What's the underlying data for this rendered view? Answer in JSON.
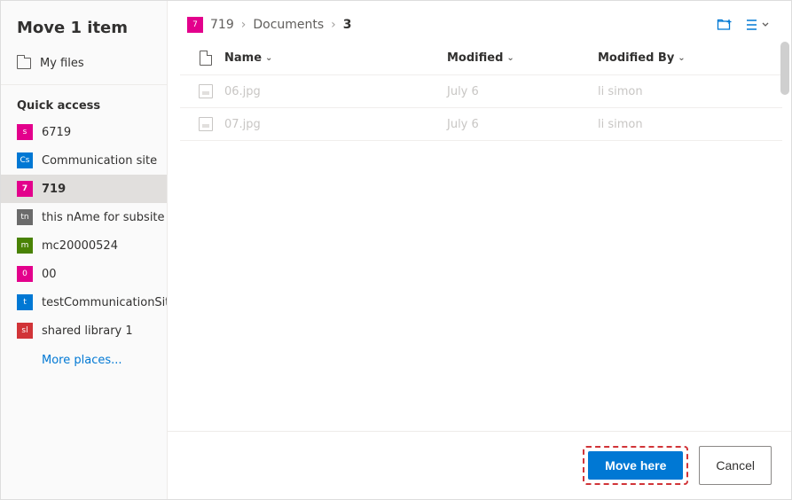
{
  "title": "Move 1 item",
  "sidebar": {
    "my_files": "My files",
    "quick_access_label": "Quick access",
    "items": [
      {
        "label": "6719",
        "color": "#e3008c",
        "initial": "s",
        "selected": false
      },
      {
        "label": "Communication site",
        "color": "#0078d4",
        "initial": "Cs",
        "selected": false
      },
      {
        "label": "719",
        "color": "#e3008c",
        "initial": "7",
        "selected": true
      },
      {
        "label": "this nAme for subsite",
        "color": "#6b6b6b",
        "initial": "tn",
        "selected": false
      },
      {
        "label": "mc20000524",
        "color": "#498205",
        "initial": "m",
        "selected": false
      },
      {
        "label": "00",
        "color": "#e3008c",
        "initial": "0",
        "selected": false
      },
      {
        "label": "testCommunicationSite",
        "color": "#0078d4",
        "initial": "t",
        "selected": false
      },
      {
        "label": "shared library 1",
        "color": "#d13438",
        "initial": "sl",
        "selected": false
      }
    ],
    "more_places": "More places..."
  },
  "breadcrumb": {
    "site_initial": "7",
    "site_color": "#e3008c",
    "crumbs": [
      "719",
      "Documents",
      "3"
    ]
  },
  "columns": {
    "name": "Name",
    "modified": "Modified",
    "modified_by": "Modified By"
  },
  "rows": [
    {
      "name": "06.jpg",
      "modified": "July 6",
      "modified_by": "li simon"
    },
    {
      "name": "07.jpg",
      "modified": "July 6",
      "modified_by": "li simon"
    }
  ],
  "footer": {
    "primary": "Move here",
    "secondary": "Cancel"
  }
}
